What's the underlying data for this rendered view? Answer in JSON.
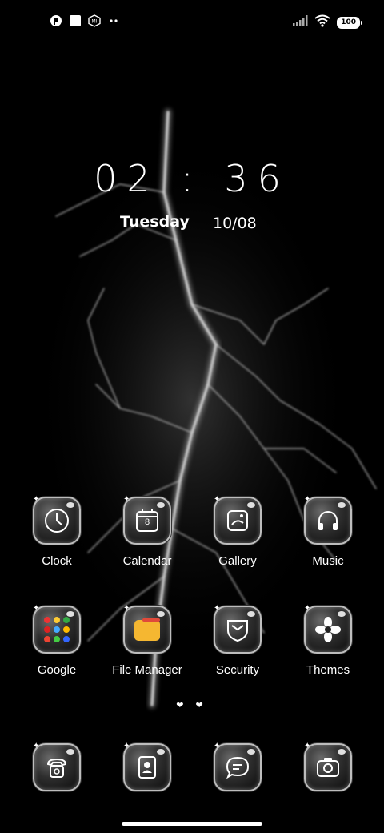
{
  "status_bar": {
    "left_icons": [
      "notification-app-icon",
      "notification-square-icon",
      "mi-icon",
      "more-dots-icon"
    ],
    "right_icons": [
      "signal-icon",
      "wifi-icon",
      "battery-icon"
    ],
    "battery": "100"
  },
  "clock": {
    "time": "02 : 36",
    "day": "Tuesday",
    "date": "10/08"
  },
  "apps_row1": [
    {
      "label": "Clock",
      "icon": "clock-icon"
    },
    {
      "label": "Calendar",
      "icon": "calendar-icon",
      "badge": "8"
    },
    {
      "label": "Gallery",
      "icon": "gallery-icon"
    },
    {
      "label": "Music",
      "icon": "headphones-icon"
    }
  ],
  "apps_row2": [
    {
      "label": "Google",
      "icon": "google-folder-icon"
    },
    {
      "label": "File Manager",
      "icon": "folder-icon"
    },
    {
      "label": "Security",
      "icon": "shield-icon"
    },
    {
      "label": "Themes",
      "icon": "flower-icon"
    }
  ],
  "page_indicator": "❤ ❤",
  "dock": [
    {
      "icon": "phone-icon"
    },
    {
      "icon": "contacts-icon"
    },
    {
      "icon": "messages-icon"
    },
    {
      "icon": "camera-icon"
    }
  ],
  "colors": {
    "background": "#000000",
    "icon_frame": "#bdbdbd",
    "folder": "#f5b731"
  }
}
